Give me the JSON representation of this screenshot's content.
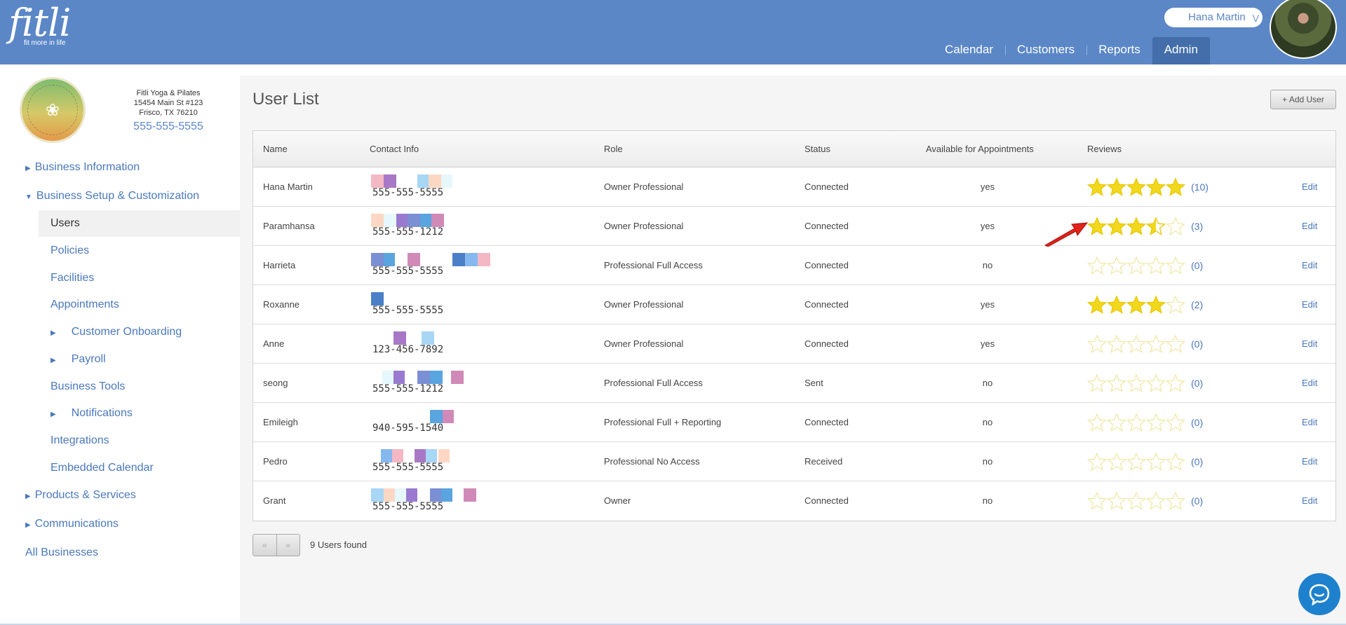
{
  "brand": {
    "name": "fitli",
    "tagline": "fit more in life"
  },
  "header": {
    "user_name": "Hana Martin",
    "nav": [
      "Calendar",
      "Customers",
      "Reports",
      "Admin"
    ],
    "active_nav": "Admin"
  },
  "business": {
    "name": "Fitli Yoga & Pilates",
    "address1": "15454 Main St #123",
    "address2": "Frisco, TX 76210",
    "phone": "555-555-5555"
  },
  "sidebar": {
    "items": [
      {
        "label": "Business Information",
        "type": "collapsed"
      },
      {
        "label": "Business Setup & Customization",
        "type": "expanded"
      },
      {
        "label": "Users",
        "type": "active"
      },
      {
        "label": "Policies",
        "type": "sub"
      },
      {
        "label": "Facilities",
        "type": "sub"
      },
      {
        "label": "Appointments",
        "type": "sub"
      },
      {
        "label": "Customer Onboarding",
        "type": "sub-collapsed"
      },
      {
        "label": "Payroll",
        "type": "sub-collapsed"
      },
      {
        "label": "Business Tools",
        "type": "sub"
      },
      {
        "label": "Notifications",
        "type": "sub-collapsed"
      },
      {
        "label": "Integrations",
        "type": "sub"
      },
      {
        "label": "Embedded Calendar",
        "type": "sub"
      },
      {
        "label": "Products & Services",
        "type": "collapsed"
      },
      {
        "label": "Communications",
        "type": "collapsed"
      },
      {
        "label": "All Businesses",
        "type": "top"
      }
    ]
  },
  "main": {
    "title": "User List",
    "add_button": "+ Add User",
    "columns": [
      "Name",
      "Contact Info",
      "Role",
      "Status",
      "Available for Appointments",
      "Reviews"
    ],
    "edit_label": "Edit",
    "rows": [
      {
        "name": "Hana Martin",
        "phone": "555-555-5555",
        "role": "Owner Professional",
        "status": "Connected",
        "available": "yes",
        "rating": 5,
        "reviews": "(10)"
      },
      {
        "name": "Paramhansa",
        "phone": "555-555-1212",
        "role": "Owner Professional",
        "status": "Connected",
        "available": "yes",
        "rating": 3.5,
        "reviews": "(3)"
      },
      {
        "name": "Harrieta",
        "phone": "555-555-5555",
        "role": "Professional Full Access",
        "status": "Connected",
        "available": "no",
        "rating": 0,
        "reviews": "(0)"
      },
      {
        "name": "Roxanne",
        "phone": "555-555-5555",
        "role": "Owner Professional",
        "status": "Connected",
        "available": "yes",
        "rating": 4,
        "reviews": "(2)"
      },
      {
        "name": "Anne",
        "phone": "123-456-7892",
        "role": "Owner Professional",
        "status": "Connected",
        "available": "yes",
        "rating": 0,
        "reviews": "(0)"
      },
      {
        "name": "seong",
        "phone": "555-555-1212",
        "role": "Professional Full Access",
        "status": "Sent",
        "available": "no",
        "rating": 0,
        "reviews": "(0)"
      },
      {
        "name": "Emileigh",
        "phone": "940-595-1540",
        "role": "Professional Full + Reporting",
        "status": "Connected",
        "available": "no",
        "rating": 0,
        "reviews": "(0)"
      },
      {
        "name": "Pedro",
        "phone": "555-555-5555",
        "role": "Professional No Access",
        "status": "Received",
        "available": "no",
        "rating": 0,
        "reviews": "(0)"
      },
      {
        "name": "Grant",
        "phone": "555-555-5555",
        "role": "Owner",
        "status": "Connected",
        "available": "no",
        "rating": 0,
        "reviews": "(0)"
      }
    ],
    "pager": {
      "prev": "«",
      "next": "»"
    },
    "found_text": "9 Users found"
  },
  "colors": {
    "header": "#5b87c7",
    "link": "#4a78bd",
    "star": "#f2d81c",
    "arrow": "#e0231b",
    "redaction": [
      "#f4b8c4",
      "#a878c6",
      "#a8d6f5",
      "#fcd8c4",
      "#e6f8fc",
      "#9a7ad0",
      "#7a8fd4",
      "#5aa4e0",
      "#d08ab8",
      "#4b7fc8",
      "#86b8f0"
    ]
  },
  "icons": {
    "user_menu": "chevron-down-icon",
    "chat": "chat-bubble-icon",
    "annotation": "red-arrow-icon"
  }
}
